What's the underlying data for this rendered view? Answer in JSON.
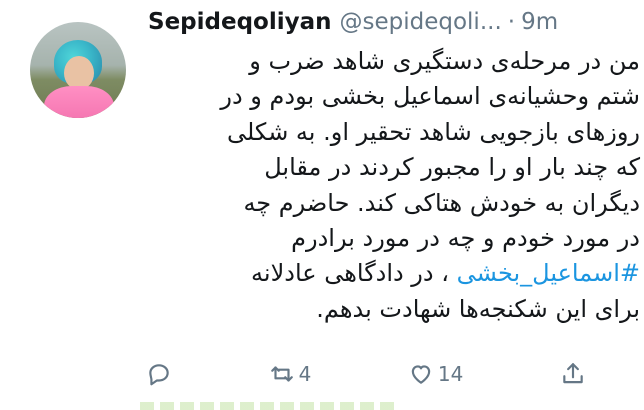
{
  "tweet": {
    "author_name": "Sepideqoliyan",
    "author_handle": "@sepideqoli...",
    "separator": "·",
    "time": "9m",
    "avatar_icon": "profile-photo",
    "lines": [
      "من در مرحله‌ی دستگیری شاهد ضرب و",
      "شتم وحشیانه‌ی اسماعیل بخشی بودم و در",
      "روزهای بازجویی شاهد تحقیر او. به شکلی",
      "که چند بار او را مجبور کردند در مقابل",
      "دیگران به خودش هتاکی کند. حاضرم چه",
      "در مورد خودم و چه در مورد برادرم"
    ],
    "hashtag": "#اسماعیل_بخشی",
    "after_hashtag": " ، در دادگاهی عادلانه",
    "last_line": "برای این شکنجه‌ها شهادت بدهم."
  },
  "actions": {
    "reply_icon": "reply-icon",
    "retweet_icon": "retweet-icon",
    "retweet_count": "4",
    "like_icon": "heart-icon",
    "like_count": "14",
    "share_icon": "share-icon"
  },
  "colors": {
    "text": "#14171a",
    "secondary": "#657786",
    "link": "#1b95e0"
  }
}
